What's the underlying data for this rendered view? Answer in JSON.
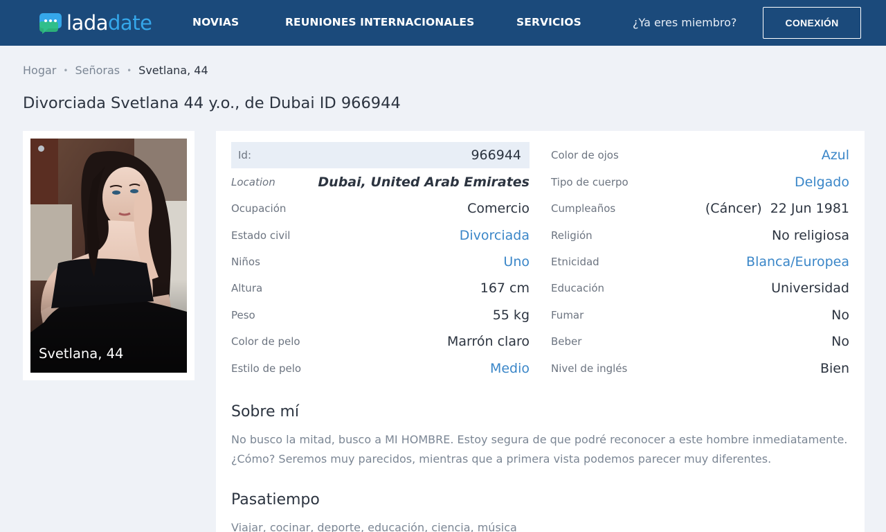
{
  "header": {
    "logo_part1": "lada",
    "logo_part2": "date",
    "nav": [
      "NOVIAS",
      "REUNIONES INTERNACIONALES",
      "SERVICIOS"
    ],
    "member_question": "¿Ya eres miembro?",
    "login_label": "CONEXIÓN"
  },
  "breadcrumb": {
    "items": [
      "Hogar",
      "Señoras"
    ],
    "current": "Svetlana, 44"
  },
  "page_title": "Divorciada Svetlana 44 y.o., de Dubai ID 966944",
  "photo": {
    "caption": "Svetlana, 44"
  },
  "profile": {
    "left": [
      {
        "label": "Id:",
        "value": "966944"
      },
      {
        "label": "Location",
        "value": "Dubai, United Arab Emirates"
      },
      {
        "label": "Ocupación",
        "value": "Comercio"
      },
      {
        "label": "Estado civil",
        "value": "Divorciada"
      },
      {
        "label": "Niños",
        "value": "Uno"
      },
      {
        "label": "Altura",
        "value": "167 cm"
      },
      {
        "label": "Peso",
        "value": "55 kg"
      },
      {
        "label": "Color de pelo",
        "value": "Marrón claro"
      },
      {
        "label": "Estilo de pelo",
        "value": "Medio"
      }
    ],
    "right": [
      {
        "label": "Color de ojos",
        "value": "Azul"
      },
      {
        "label": "Tipo de cuerpo",
        "value": "Delgado"
      },
      {
        "label": "Cumpleaños",
        "value": "(Cáncer)  22 Jun 1981"
      },
      {
        "label": "Religión",
        "value": "No religiosa"
      },
      {
        "label": "Etnicidad",
        "value": "Blanca/Europea"
      },
      {
        "label": "Educación",
        "value": "Universidad"
      },
      {
        "label": "Fumar",
        "value": "No"
      },
      {
        "label": "Beber",
        "value": "No"
      },
      {
        "label": "Nivel de inglés",
        "value": "Bien"
      }
    ]
  },
  "about": {
    "title": "Sobre mí",
    "text": "No busco la mitad, busco a MI HOMBRE. Estoy segura de que podré reconocer a este hombre inmediatamente. ¿Cómo? Seremos muy parecidos, mientras que a primera vista podemos parecer muy diferentes."
  },
  "hobby": {
    "title": "Pasatiempo",
    "text": "Viajar, cocinar, deporte, educación, ciencia, música"
  },
  "colors": {
    "header_bg": "#1b4a7b",
    "accent": "#35a7ea",
    "link": "#3a86c8",
    "page_bg": "#eff2f7"
  },
  "icons": {
    "logo": "chat-bubble-icon"
  }
}
